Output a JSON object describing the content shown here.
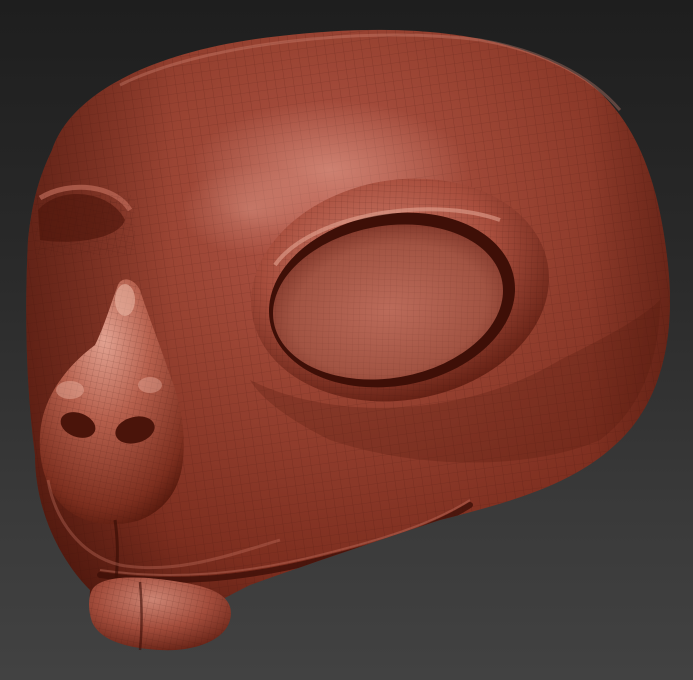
{
  "scene": {
    "subject": "sculpted-head-mesh",
    "colors": {
      "background_top": "#1e1e1e",
      "background_bottom": "#424242",
      "clay_base": "#8f3a28",
      "clay_light": "#c06a55",
      "clay_highlight": "#e6aa98",
      "clay_shadow": "#4a150c",
      "wire": "#3a0f08"
    }
  }
}
